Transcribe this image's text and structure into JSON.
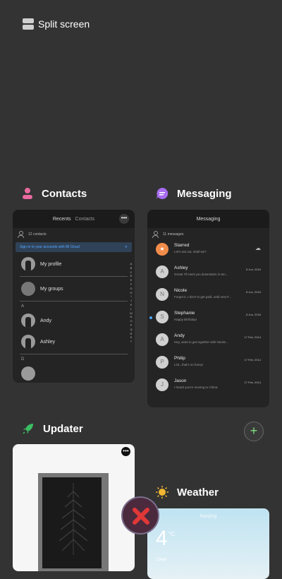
{
  "split_screen": {
    "label": "Split screen"
  },
  "colors": {
    "contacts": "#e86a9e",
    "messaging": "#a86cf0",
    "updater": "#3bbd63",
    "weather": "#f2b632",
    "close": "#e03838"
  },
  "contacts": {
    "app_name": "Contacts",
    "tabs": [
      "Recents",
      "Contacts"
    ],
    "count": "12 contacts",
    "banner": "Sign in to your accounts with Mi Cloud",
    "rows": [
      "My profile",
      "My groups"
    ],
    "section_a": "A",
    "people": [
      "Andy",
      "Ashley"
    ],
    "section_d": "D",
    "index": [
      "A",
      "B",
      "C",
      "D",
      "E",
      "F",
      "G",
      "H",
      "I",
      "J",
      "K",
      "L",
      "M",
      "N",
      "O",
      "P",
      "Q",
      "R",
      "S",
      "T"
    ]
  },
  "messaging": {
    "app_name": "Messaging",
    "title": "Messaging",
    "count": "11 messages",
    "items": [
      {
        "initial": "★",
        "name": "Starred",
        "text": "Let's eat out, shall we?",
        "date": ""
      },
      {
        "initial": "A",
        "name": "Ashley",
        "text": "Great! I'll meet you downstairs in ten...",
        "date": "8 Jun, 2016"
      },
      {
        "initial": "N",
        "name": "Nicole",
        "text": "Forget it, I don't to get paid, until next F...",
        "date": "8 Jun, 2016"
      },
      {
        "initial": "S",
        "name": "Stephanie",
        "text": "Happy Birthday!",
        "date": "8 Jun, 2016"
      },
      {
        "initial": "A",
        "name": "Andy",
        "text": "Hey, want to get together with Nicole...",
        "date": "17 Feb, 2014"
      },
      {
        "initial": "P",
        "name": "Philip",
        "text": "LOL, that's so funny!",
        "date": "17 Feb, 2014"
      },
      {
        "initial": "J",
        "name": "Jason",
        "text": "I heard you're moving to China.",
        "date": "17 Feb, 2014"
      }
    ]
  },
  "updater": {
    "app_name": "Updater"
  },
  "weather": {
    "app_name": "Weather",
    "city": "Nanjing",
    "temp": "4",
    "unit": "°C",
    "condition": "Clear"
  }
}
